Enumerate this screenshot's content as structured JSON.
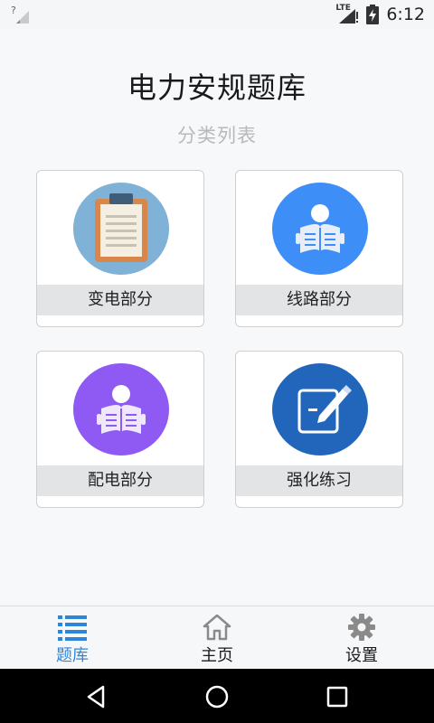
{
  "status_bar": {
    "network_label": "LTE",
    "time": "6:12",
    "colors": {
      "icon": "#555555"
    }
  },
  "header": {
    "title": "电力安规题库",
    "subtitle": "分类列表"
  },
  "categories": [
    {
      "label": "变电部分",
      "icon": "clipboard-icon",
      "color": "#7fb2d6"
    },
    {
      "label": "线路部分",
      "icon": "reading-person-icon",
      "color": "#3d8ef7"
    },
    {
      "label": "配电部分",
      "icon": "reading-person-icon",
      "color": "#8e5af3"
    },
    {
      "label": "强化练习",
      "icon": "edit-pen-icon",
      "color": "#2266bb"
    }
  ],
  "bottom_nav": {
    "items": [
      {
        "label": "题库",
        "icon": "list-icon",
        "active": true
      },
      {
        "label": "主页",
        "icon": "home-icon",
        "active": false
      },
      {
        "label": "设置",
        "icon": "gear-icon",
        "active": false
      }
    ],
    "active_color": "#2f86d8",
    "inactive_color": "#1a1a1a",
    "inactive_icon_color": "#8a8a8a"
  }
}
